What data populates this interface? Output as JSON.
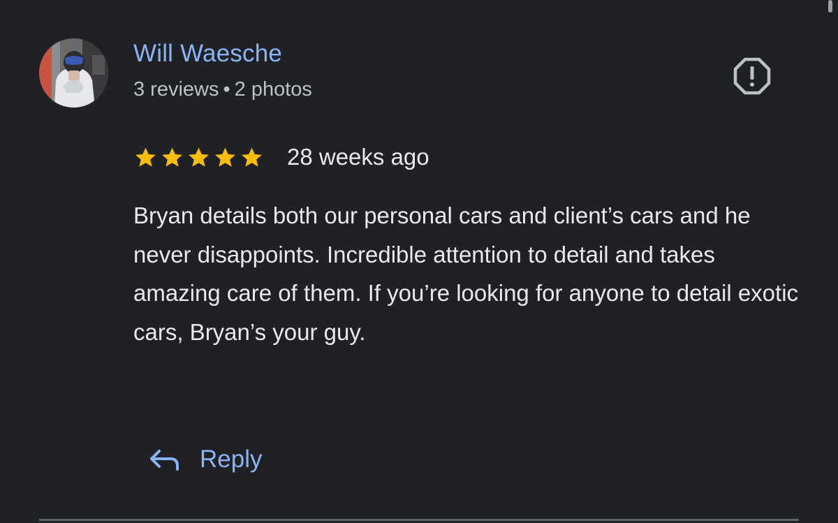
{
  "review": {
    "author": {
      "name": "Will Waesche",
      "reviews_count": "3 reviews",
      "separator": "•",
      "photos_count": "2 photos"
    },
    "rating": {
      "stars": 5,
      "max_stars": 5,
      "star_color": "#fbbc04"
    },
    "date": "28 weeks ago",
    "text": "Bryan details both our personal cars and client’s cars and he never disappoints. Incredible attention to detail and takes amazing care of them. If you’re looking for anyone to detail exotic cars, Bryan’s your guy.",
    "actions": {
      "reply_label": "Reply",
      "reply_icon": "reply-arrow-icon",
      "report_icon": "report-octagon-icon"
    }
  },
  "colors": {
    "background": "#202124",
    "link": "#8ab4f8",
    "primary_text": "#e8eaed",
    "secondary_text": "#bdc1c6"
  }
}
